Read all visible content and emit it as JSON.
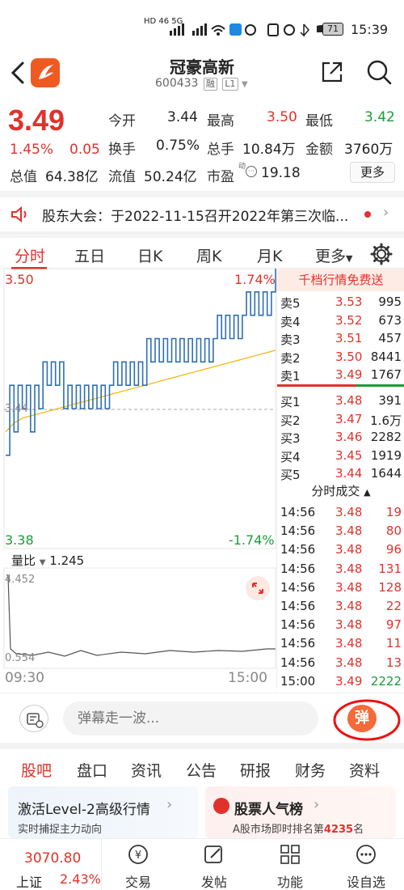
{
  "status_bar": {
    "left_icons": "HD 46 5G",
    "time": "15:39",
    "battery": "71"
  },
  "header": {
    "title": "冠豪高新",
    "code": "600433",
    "tag_rong": "融",
    "tag_level": "L1"
  },
  "quote": {
    "price": "3.49",
    "change_pct": "1.45%",
    "change": "0.05",
    "open_label": "今开",
    "open": "3.44",
    "high_label": "最高",
    "high": "3.50",
    "low_label": "最低",
    "low": "3.42",
    "turnover_label": "换手",
    "turnover": "0.75%",
    "volume_label": "总手",
    "volume": "10.84万",
    "amount_label": "金额",
    "amount": "3760万",
    "mcap_label": "总值",
    "mcap": "64.38亿",
    "float_label": "流值",
    "float": "50.24亿",
    "pe_label": "市盈",
    "pe_sup": "动",
    "pe": "19.18",
    "more_label": "更多"
  },
  "notice": {
    "text": "股东大会：于2022-11-15召开2022年第三次临..."
  },
  "chart_tabs": [
    "分时",
    "五日",
    "日K",
    "周K",
    "月K",
    "更多"
  ],
  "chart": {
    "top_price": "3.50",
    "top_pct": "1.74%",
    "bottom_price": "3.38",
    "bottom_pct": "-1.74%",
    "ref_price": "3.44",
    "volume_ratio_label": "量比",
    "volume_ratio": "1.245",
    "vr_top": "4.452",
    "vr_bottom": "0.554",
    "time_start": "09:30",
    "time_end": "15:00"
  },
  "chart_data": {
    "type": "line",
    "ylim": [
      3.38,
      3.5
    ],
    "series": [
      {
        "values": [
          3.42,
          3.45,
          3.43,
          3.45,
          3.44,
          3.45,
          3.43,
          3.45,
          3.44,
          3.46,
          3.45,
          3.46,
          3.45,
          3.46,
          3.44,
          3.45,
          3.44,
          3.45,
          3.44,
          3.45,
          3.44,
          3.45,
          3.44,
          3.45,
          3.44,
          3.45,
          3.46,
          3.45,
          3.46,
          3.45,
          3.46,
          3.45,
          3.46,
          3.45,
          3.47,
          3.46,
          3.47,
          3.46,
          3.47,
          3.46,
          3.47,
          3.46,
          3.47,
          3.46,
          3.47,
          3.46,
          3.47,
          3.46,
          3.47,
          3.46,
          3.47,
          3.48,
          3.47,
          3.48,
          3.47,
          3.48,
          3.47,
          3.48,
          3.49,
          3.48,
          3.49,
          3.48,
          3.49,
          3.48,
          3.49,
          3.5
        ]
      },
      {
        "values": [
          3.43,
          3.434,
          3.436,
          3.437,
          3.438,
          3.439,
          3.44,
          3.441,
          3.442,
          3.443,
          3.444,
          3.445,
          3.446,
          3.447,
          3.448,
          3.449,
          3.45,
          3.451,
          3.452,
          3.453,
          3.454,
          3.455,
          3.456,
          3.457,
          3.458,
          3.459,
          3.46,
          3.461,
          3.462,
          3.463,
          3.464,
          3.465
        ]
      }
    ]
  },
  "orderbook": {
    "banner": "千档行情免费送",
    "asks": [
      {
        "label": "卖5",
        "price": "3.53",
        "vol": "995"
      },
      {
        "label": "卖4",
        "price": "3.52",
        "vol": "673"
      },
      {
        "label": "卖3",
        "price": "3.51",
        "vol": "457"
      },
      {
        "label": "卖2",
        "price": "3.50",
        "vol": "8441"
      },
      {
        "label": "卖1",
        "price": "3.49",
        "vol": "1767"
      }
    ],
    "bids": [
      {
        "label": "买1",
        "price": "3.48",
        "vol": "391"
      },
      {
        "label": "买2",
        "price": "3.47",
        "vol": "1.6万"
      },
      {
        "label": "买3",
        "price": "3.46",
        "vol": "2282"
      },
      {
        "label": "买4",
        "price": "3.45",
        "vol": "1919"
      },
      {
        "label": "买5",
        "price": "3.44",
        "vol": "1644"
      }
    ],
    "ticks_title": "分时成交",
    "ticks": [
      {
        "time": "14:56",
        "price": "3.48",
        "vol": "19"
      },
      {
        "time": "14:56",
        "price": "3.48",
        "vol": "80"
      },
      {
        "time": "14:56",
        "price": "3.48",
        "vol": "96"
      },
      {
        "time": "14:56",
        "price": "3.48",
        "vol": "131"
      },
      {
        "time": "14:56",
        "price": "3.48",
        "vol": "128"
      },
      {
        "time": "14:56",
        "price": "3.48",
        "vol": "22"
      },
      {
        "time": "14:56",
        "price": "3.48",
        "vol": "97"
      },
      {
        "time": "14:56",
        "price": "3.48",
        "vol": "11"
      },
      {
        "time": "14:56",
        "price": "3.48",
        "vol": "13"
      },
      {
        "time": "15:00",
        "price": "3.49",
        "vol": "2222"
      }
    ]
  },
  "comment": {
    "placeholder": "弹幕走一波...",
    "danmu_label": "弹"
  },
  "bottom_tabs": [
    "股吧",
    "盘口",
    "资讯",
    "公告",
    "研报",
    "财务",
    "资料"
  ],
  "cards": {
    "left_title": "激活Level-2高级行情",
    "left_sub": "实时捕捉主力动向",
    "right_title": "股票人气榜",
    "right_sub_a": "A股市场即时排名第",
    "right_sub_num": "4235",
    "right_sub_b": "名"
  },
  "bottom_nav": {
    "index_value": "3070.80",
    "index_name": "上证",
    "index_pct": "2.43%",
    "items": [
      "交易",
      "发帖",
      "功能",
      "设自选"
    ]
  }
}
